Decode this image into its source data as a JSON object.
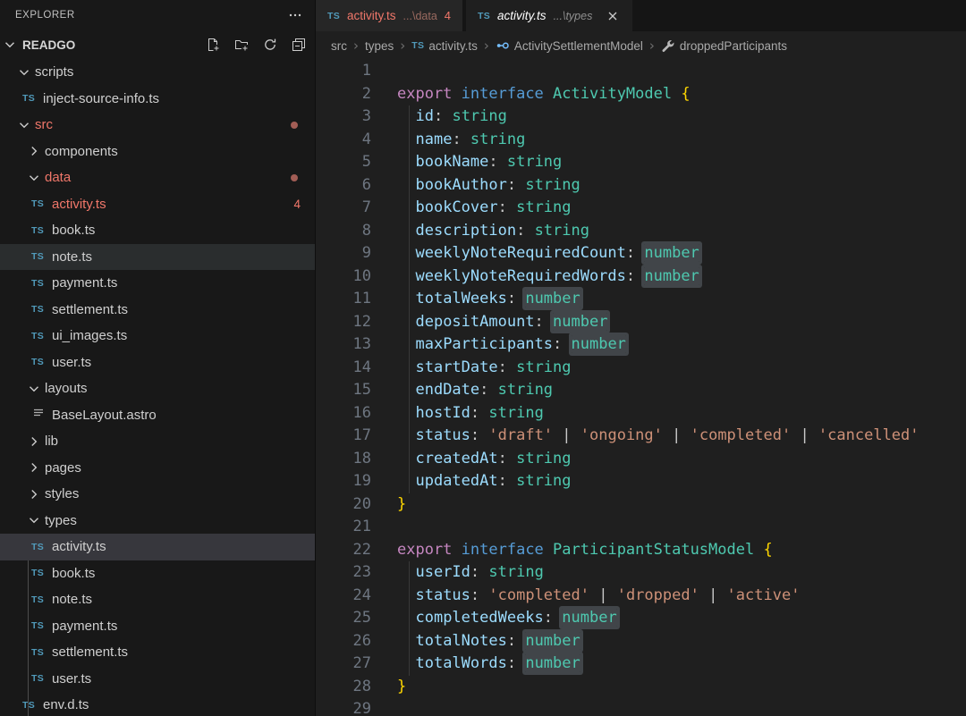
{
  "colors": {
    "editor_bg": "#1f1f1f",
    "sidebar_bg": "#181818",
    "error_red": "#f0776a",
    "modified_dot": "#a25d55",
    "ts_icon_blue": "#519aba",
    "symbol_interface_blue": "#75beff",
    "keyword": "#c586c0",
    "keyword2": "#569cd6",
    "type_teal": "#4ec9b0",
    "property_blue": "#9cdcfe",
    "string_orange": "#ce9178",
    "brace_gold": "#ffd700",
    "occurrence_highlight": "#414549"
  },
  "explorer": {
    "title": "EXPLORER",
    "section": {
      "name": "READGO",
      "actions": [
        {
          "name": "new-file"
        },
        {
          "name": "new-folder"
        },
        {
          "name": "refresh"
        },
        {
          "name": "collapse-all"
        }
      ]
    },
    "tree": [
      {
        "label": "scripts",
        "kind": "folder",
        "level": 1,
        "expanded": true
      },
      {
        "label": "inject-source-info.ts",
        "kind": "file",
        "icon": "ts",
        "level": 2
      },
      {
        "label": "src",
        "kind": "folder",
        "level": 1,
        "expanded": true,
        "error": true,
        "dot": true
      },
      {
        "label": "components",
        "kind": "folder",
        "level": 2,
        "expanded": false
      },
      {
        "label": "data",
        "kind": "folder",
        "level": 2,
        "expanded": true,
        "error": true,
        "dot": true
      },
      {
        "label": "activity.ts",
        "kind": "file",
        "icon": "ts",
        "level": 3,
        "error": true,
        "badge": "4"
      },
      {
        "label": "book.ts",
        "kind": "file",
        "icon": "ts",
        "level": 3
      },
      {
        "label": "note.ts",
        "kind": "file",
        "icon": "ts",
        "level": 3,
        "state": "hover"
      },
      {
        "label": "payment.ts",
        "kind": "file",
        "icon": "ts",
        "level": 3
      },
      {
        "label": "settlement.ts",
        "kind": "file",
        "icon": "ts",
        "level": 3
      },
      {
        "label": "ui_images.ts",
        "kind": "file",
        "icon": "ts",
        "level": 3
      },
      {
        "label": "user.ts",
        "kind": "file",
        "icon": "ts",
        "level": 3
      },
      {
        "label": "layouts",
        "kind": "folder",
        "level": 2,
        "expanded": true
      },
      {
        "label": "BaseLayout.astro",
        "kind": "file",
        "icon": "lines",
        "level": 3
      },
      {
        "label": "lib",
        "kind": "folder",
        "level": 2,
        "expanded": false
      },
      {
        "label": "pages",
        "kind": "folder",
        "level": 2,
        "expanded": false
      },
      {
        "label": "styles",
        "kind": "folder",
        "level": 2,
        "expanded": false
      },
      {
        "label": "types",
        "kind": "folder",
        "level": 2,
        "expanded": true,
        "guide_children": true
      },
      {
        "label": "activity.ts",
        "kind": "file",
        "icon": "ts",
        "level": 3,
        "state": "selected"
      },
      {
        "label": "book.ts",
        "kind": "file",
        "icon": "ts",
        "level": 3
      },
      {
        "label": "note.ts",
        "kind": "file",
        "icon": "ts",
        "level": 3
      },
      {
        "label": "payment.ts",
        "kind": "file",
        "icon": "ts",
        "level": 3
      },
      {
        "label": "settlement.ts",
        "kind": "file",
        "icon": "ts",
        "level": 3
      },
      {
        "label": "user.ts",
        "kind": "file",
        "icon": "ts",
        "level": 3
      },
      {
        "label": "env.d.ts",
        "kind": "file",
        "icon": "ts",
        "level": 2
      }
    ]
  },
  "tabs": [
    {
      "icon": "TS",
      "name": "activity.ts",
      "path_hint": "...\\data",
      "badge": "4",
      "active": false,
      "error": true,
      "close": false
    },
    {
      "icon": "TS",
      "name": "activity.ts",
      "path_hint": "...\\types",
      "active": true,
      "preview": true,
      "close": true
    }
  ],
  "breadcrumb": [
    {
      "label": "src"
    },
    {
      "label": "types"
    },
    {
      "label": "activity.ts",
      "icon": "ts"
    },
    {
      "label": "ActivitySettlementModel",
      "icon": "interface"
    },
    {
      "label": "droppedParticipants",
      "icon": "wrench"
    }
  ],
  "editor": {
    "lines": [
      [],
      [
        [
          "k1",
          "export"
        ],
        [
          "pu",
          " "
        ],
        [
          "k2",
          "interface"
        ],
        [
          "pu",
          " "
        ],
        [
          "ty",
          "ActivityModel"
        ],
        [
          "pu",
          " "
        ],
        [
          "br",
          "{"
        ]
      ],
      [
        [
          "pu",
          "  "
        ],
        [
          "pr",
          "id"
        ],
        [
          "pu",
          ": "
        ],
        [
          "ty",
          "string"
        ]
      ],
      [
        [
          "pu",
          "  "
        ],
        [
          "pr",
          "name"
        ],
        [
          "pu",
          ": "
        ],
        [
          "ty",
          "string"
        ]
      ],
      [
        [
          "pu",
          "  "
        ],
        [
          "pr",
          "bookName"
        ],
        [
          "pu",
          ": "
        ],
        [
          "ty",
          "string"
        ]
      ],
      [
        [
          "pu",
          "  "
        ],
        [
          "pr",
          "bookAuthor"
        ],
        [
          "pu",
          ": "
        ],
        [
          "ty",
          "string"
        ]
      ],
      [
        [
          "pu",
          "  "
        ],
        [
          "pr",
          "bookCover"
        ],
        [
          "pu",
          ": "
        ],
        [
          "ty",
          "string"
        ]
      ],
      [
        [
          "pu",
          "  "
        ],
        [
          "pr",
          "description"
        ],
        [
          "pu",
          ": "
        ],
        [
          "ty",
          "string"
        ]
      ],
      [
        [
          "pu",
          "  "
        ],
        [
          "pr",
          "weeklyNoteRequiredCount"
        ],
        [
          "pu",
          ": "
        ],
        [
          "tyh",
          "number"
        ]
      ],
      [
        [
          "pu",
          "  "
        ],
        [
          "pr",
          "weeklyNoteRequiredWords"
        ],
        [
          "pu",
          ": "
        ],
        [
          "tyh",
          "number"
        ]
      ],
      [
        [
          "pu",
          "  "
        ],
        [
          "pr",
          "totalWeeks"
        ],
        [
          "pu",
          ": "
        ],
        [
          "tyh",
          "number"
        ]
      ],
      [
        [
          "pu",
          "  "
        ],
        [
          "pr",
          "depositAmount"
        ],
        [
          "pu",
          ": "
        ],
        [
          "tyh",
          "number"
        ]
      ],
      [
        [
          "pu",
          "  "
        ],
        [
          "pr",
          "maxParticipants"
        ],
        [
          "pu",
          ": "
        ],
        [
          "tyh",
          "number"
        ]
      ],
      [
        [
          "pu",
          "  "
        ],
        [
          "pr",
          "startDate"
        ],
        [
          "pu",
          ": "
        ],
        [
          "ty",
          "string"
        ]
      ],
      [
        [
          "pu",
          "  "
        ],
        [
          "pr",
          "endDate"
        ],
        [
          "pu",
          ": "
        ],
        [
          "ty",
          "string"
        ]
      ],
      [
        [
          "pu",
          "  "
        ],
        [
          "pr",
          "hostId"
        ],
        [
          "pu",
          ": "
        ],
        [
          "ty",
          "string"
        ]
      ],
      [
        [
          "pu",
          "  "
        ],
        [
          "pr",
          "status"
        ],
        [
          "pu",
          ": "
        ],
        [
          "st",
          "'draft'"
        ],
        [
          "pu",
          " | "
        ],
        [
          "st",
          "'ongoing'"
        ],
        [
          "pu",
          " | "
        ],
        [
          "st",
          "'completed'"
        ],
        [
          "pu",
          " | "
        ],
        [
          "st",
          "'cancelled'"
        ]
      ],
      [
        [
          "pu",
          "  "
        ],
        [
          "pr",
          "createdAt"
        ],
        [
          "pu",
          ": "
        ],
        [
          "ty",
          "string"
        ]
      ],
      [
        [
          "pu",
          "  "
        ],
        [
          "pr",
          "updatedAt"
        ],
        [
          "pu",
          ": "
        ],
        [
          "ty",
          "string"
        ]
      ],
      [
        [
          "br",
          "}"
        ]
      ],
      [],
      [
        [
          "k1",
          "export"
        ],
        [
          "pu",
          " "
        ],
        [
          "k2",
          "interface"
        ],
        [
          "pu",
          " "
        ],
        [
          "ty",
          "ParticipantStatusModel"
        ],
        [
          "pu",
          " "
        ],
        [
          "br",
          "{"
        ]
      ],
      [
        [
          "pu",
          "  "
        ],
        [
          "pr",
          "userId"
        ],
        [
          "pu",
          ": "
        ],
        [
          "ty",
          "string"
        ]
      ],
      [
        [
          "pu",
          "  "
        ],
        [
          "pr",
          "status"
        ],
        [
          "pu",
          ": "
        ],
        [
          "st",
          "'completed'"
        ],
        [
          "pu",
          " | "
        ],
        [
          "st",
          "'dropped'"
        ],
        [
          "pu",
          " | "
        ],
        [
          "st",
          "'active'"
        ]
      ],
      [
        [
          "pu",
          "  "
        ],
        [
          "pr",
          "completedWeeks"
        ],
        [
          "pu",
          ": "
        ],
        [
          "tyh",
          "number"
        ]
      ],
      [
        [
          "pu",
          "  "
        ],
        [
          "pr",
          "totalNotes"
        ],
        [
          "pu",
          ": "
        ],
        [
          "tyh",
          "number"
        ]
      ],
      [
        [
          "pu",
          "  "
        ],
        [
          "pr",
          "totalWords"
        ],
        [
          "pu",
          ": "
        ],
        [
          "tyh",
          "number"
        ]
      ],
      [
        [
          "br",
          "}"
        ]
      ],
      []
    ]
  }
}
